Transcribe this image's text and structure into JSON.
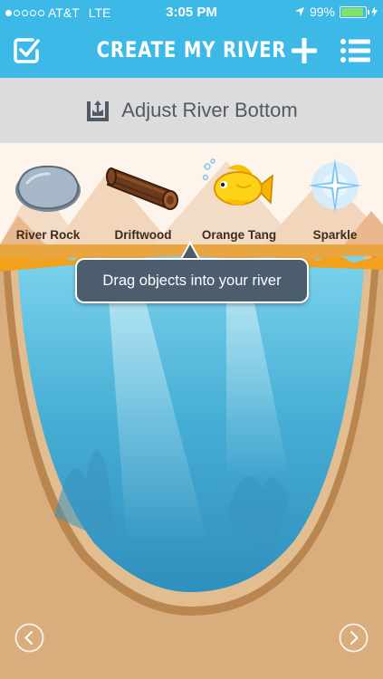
{
  "status_bar": {
    "carrier": "AT&T",
    "network": "LTE",
    "time": "3:05 PM",
    "battery_percent": "99%",
    "signal_bars_filled": 1,
    "signal_bars_total": 5
  },
  "nav": {
    "title": "CREATE MY RIVER",
    "left_icon": "checkmark-square-icon",
    "add_icon": "plus-icon",
    "menu_icon": "list-icon"
  },
  "adjust_bar": {
    "label": "Adjust River Bottom",
    "icon": "adjust-bottom-icon"
  },
  "objects": [
    {
      "label": "River Rock",
      "icon": "river-rock-icon"
    },
    {
      "label": "Driftwood",
      "icon": "driftwood-icon"
    },
    {
      "label": "Orange Tang",
      "icon": "orange-tang-fish-icon"
    },
    {
      "label": "Sparkle",
      "icon": "sparkle-icon"
    }
  ],
  "tooltip": {
    "text": "Drag objects into your river"
  },
  "colors": {
    "header_blue": "#3cb9e6",
    "adjust_bar_gray": "#dcdcdc",
    "water": "#4fb6d8",
    "sand": "#e9c59b"
  }
}
